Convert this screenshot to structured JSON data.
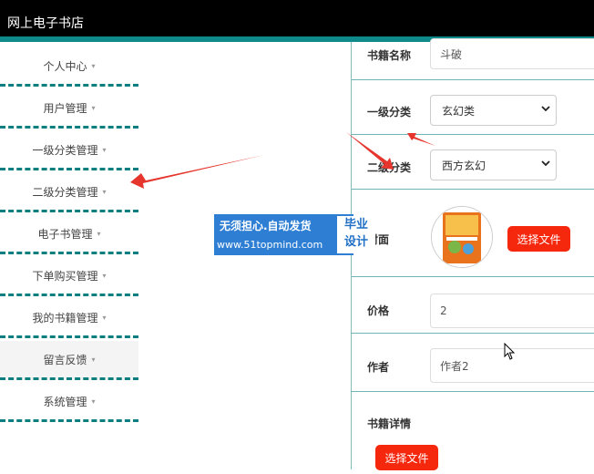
{
  "app": {
    "title": "网上电子书店"
  },
  "sidebar": {
    "items": [
      {
        "label": "个人中心"
      },
      {
        "label": "用户管理"
      },
      {
        "label": "一级分类管理"
      },
      {
        "label": "二级分类管理"
      },
      {
        "label": "电子书管理"
      },
      {
        "label": "下单购买管理"
      },
      {
        "label": "我的书籍管理"
      },
      {
        "label": "留言反馈"
      },
      {
        "label": "系统管理"
      }
    ],
    "caret": "▾"
  },
  "form": {
    "book_name": {
      "label": "书籍名称",
      "value": "斗破"
    },
    "category1": {
      "label": "一级分类",
      "value": "玄幻类"
    },
    "category2": {
      "label": "二级分类",
      "value": "西方玄幻"
    },
    "cover": {
      "label": "封面",
      "button": "选择文件"
    },
    "price": {
      "label": "价格",
      "value": "2"
    },
    "author": {
      "label": "作者",
      "value": "作者2"
    },
    "details": {
      "label": "书籍详情",
      "button": "选择文件"
    }
  },
  "watermark": {
    "line1": "无须担心.自动发货",
    "line2": "www.51topmind.com",
    "box_line1": "毕业",
    "box_line2": "设计"
  },
  "colors": {
    "accent": "#0e8a8a",
    "button": "#f5270d",
    "watermark": "#2e7fd4"
  }
}
